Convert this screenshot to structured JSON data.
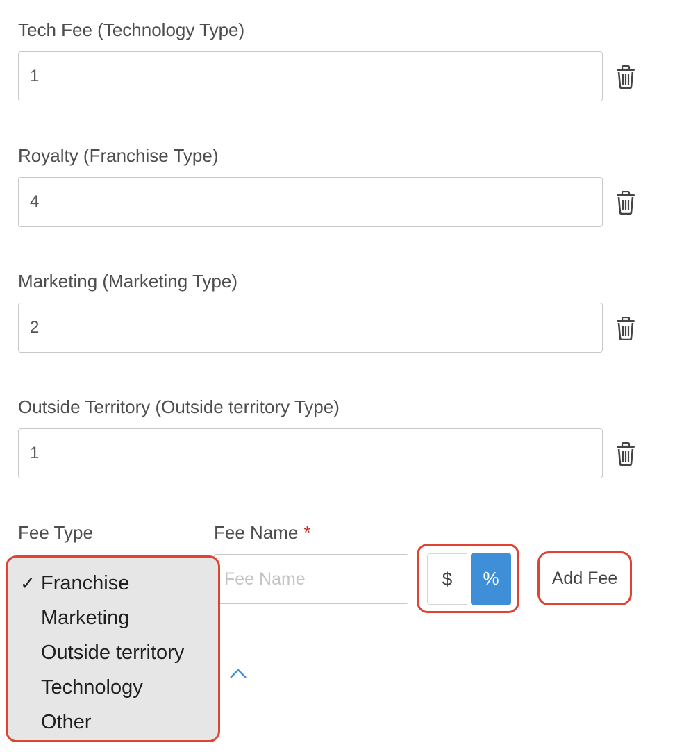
{
  "fees": [
    {
      "label": "Tech Fee (Technology Type)",
      "value": "1"
    },
    {
      "label": "Royalty (Franchise Type)",
      "value": "4"
    },
    {
      "label": "Marketing (Marketing Type)",
      "value": "2"
    },
    {
      "label": "Outside Territory (Outside territory Type)",
      "value": "1"
    }
  ],
  "new_fee": {
    "fee_type_label": "Fee Type",
    "fee_name_label": "Fee Name",
    "required_mark": "*",
    "fee_name_placeholder": "Fee Name",
    "unit_dollar": "$",
    "unit_percent": "%",
    "add_button": "Add Fee"
  },
  "dropdown": {
    "selected_mark": "✓",
    "options": [
      "Franchise",
      "Marketing",
      "Outside territory",
      "Technology",
      "Other"
    ]
  },
  "colors": {
    "highlight": "#e0442f",
    "accent": "#3f8fd8"
  }
}
